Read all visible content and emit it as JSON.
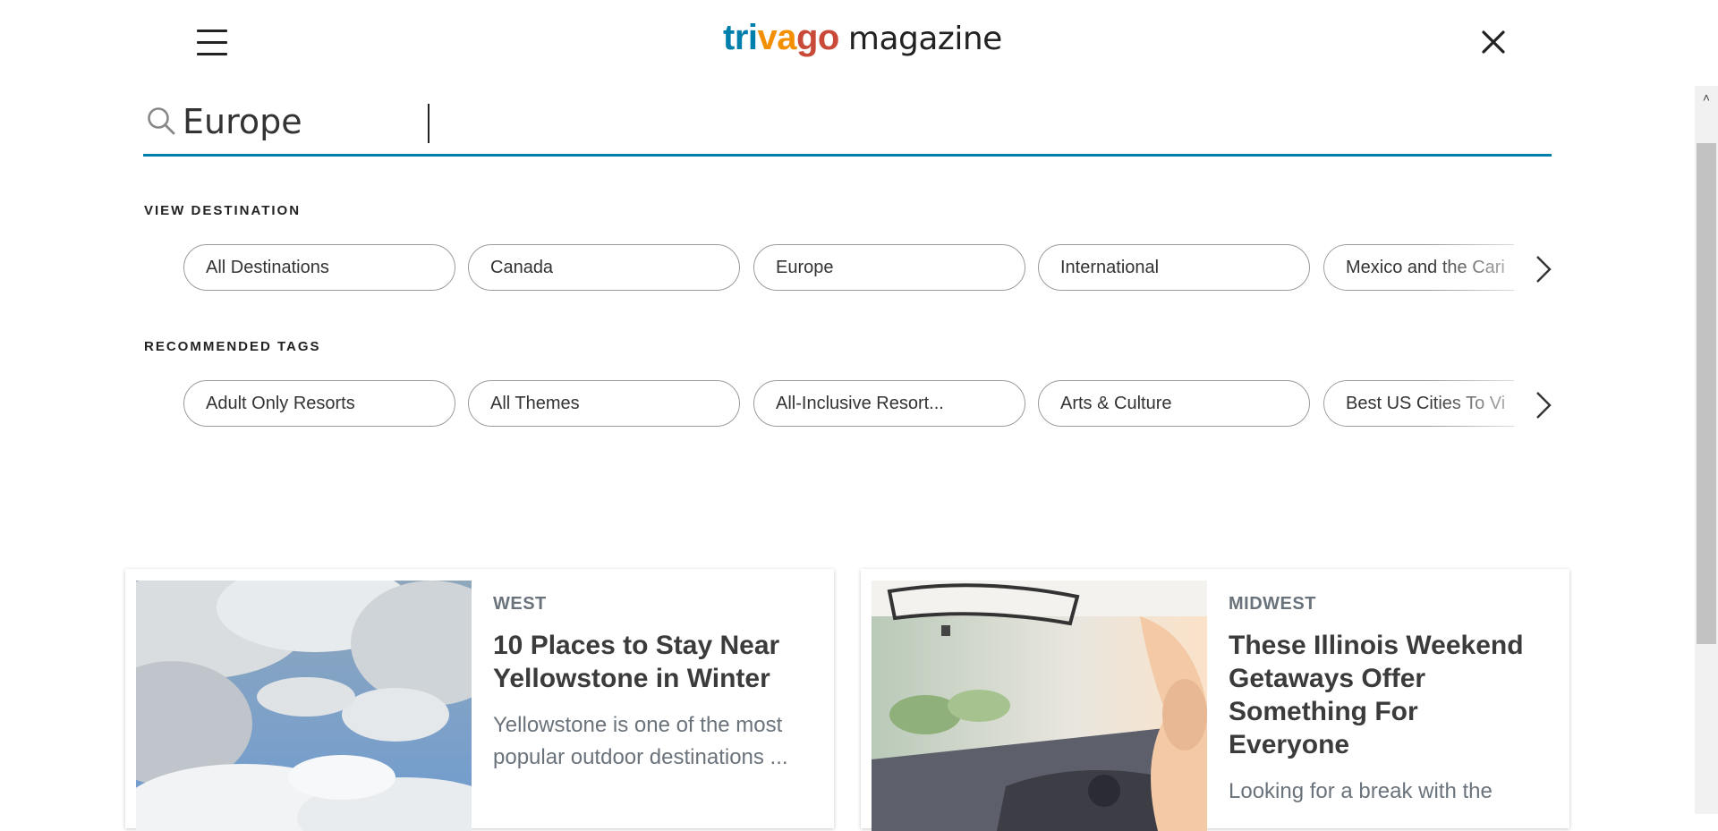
{
  "header": {
    "logo": {
      "part1": "tri",
      "part2": "va",
      "part3": "go",
      "magazine": "magazine"
    }
  },
  "search": {
    "value": "Europe",
    "placeholder": ""
  },
  "destinations": {
    "label": "VIEW DESTINATION",
    "items": [
      "All Destinations",
      "Canada",
      "Europe",
      "International",
      "Mexico and the Cari"
    ]
  },
  "tags": {
    "label": "RECOMMENDED TAGS",
    "items": [
      "Adult Only Resorts",
      "All Themes",
      "All-Inclusive Resort...",
      "Arts & Culture",
      "Best US Cities To Vi"
    ]
  },
  "cards": [
    {
      "region": "WEST",
      "title": "10 Places to Stay Near Yellowstone in Winter",
      "excerpt": "Yellowstone is one of the most popular outdoor destinations ..."
    },
    {
      "region": "MIDWEST",
      "title": "These Illinois Weekend Getaways Offer Something For Everyone",
      "excerpt": "Looking for a break with the"
    }
  ],
  "colors": {
    "brand_blue": "#007fad",
    "brand_orange": "#f48f00",
    "brand_red": "#c94a38",
    "muted_text": "#6a737b"
  },
  "icons": [
    "menu-icon",
    "close-icon",
    "search-icon",
    "chevron-right-icon",
    "scroll-up-arrow-icon"
  ]
}
